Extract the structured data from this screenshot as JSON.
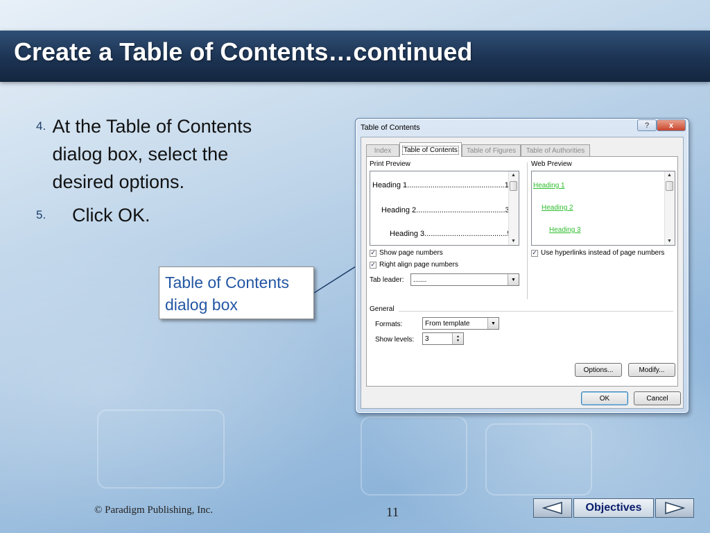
{
  "slide": {
    "title": "Create a Table of Contents…continued",
    "steps": [
      {
        "number": "4.",
        "text": "At the Table of Contents dialog box, select the desired options."
      },
      {
        "number": "5.",
        "text": "Click OK."
      }
    ],
    "callout": "Table of Contents dialog box",
    "footer_copyright": "© Paradigm Publishing, Inc.",
    "page_number": "11",
    "nav": {
      "objectives_label": "Objectives",
      "prev_icon": "triangle-left-icon",
      "next_icon": "triangle-right-icon"
    }
  },
  "dialog": {
    "title": "Table of Contents",
    "help_label": "?",
    "close_label": "x",
    "tabs": [
      "Index",
      "Table of Contents",
      "Table of Figures",
      "Table of Authorities"
    ],
    "active_tab": "Table of Contents",
    "print_preview": {
      "label": "Print Preview",
      "lines": [
        {
          "text": "Heading 1..............................................1"
        },
        {
          "text": "Heading 2..........................................3"
        },
        {
          "text": "Heading 3.......................................5"
        }
      ]
    },
    "web_preview": {
      "label": "Web Preview",
      "lines": [
        "Heading 1",
        "Heading 2",
        "Heading 3"
      ]
    },
    "show_page_numbers": {
      "label": "Show page numbers",
      "checked": true
    },
    "right_align": {
      "label": "Right align page numbers",
      "checked": true
    },
    "use_hyperlinks": {
      "label": "Use hyperlinks instead of page numbers",
      "checked": true
    },
    "tab_leader": {
      "label": "Tab leader:",
      "value": "......."
    },
    "general_label": "General",
    "formats": {
      "label": "Formats:",
      "value": "From template"
    },
    "show_levels": {
      "label": "Show levels:",
      "value": "3"
    },
    "options_label": "Options...",
    "modify_label": "Modify...",
    "ok_label": "OK",
    "cancel_label": "Cancel"
  },
  "colors": {
    "title_bar": "#1c3353",
    "callout_text": "#2356a3",
    "web_link": "#2cbd2c"
  }
}
